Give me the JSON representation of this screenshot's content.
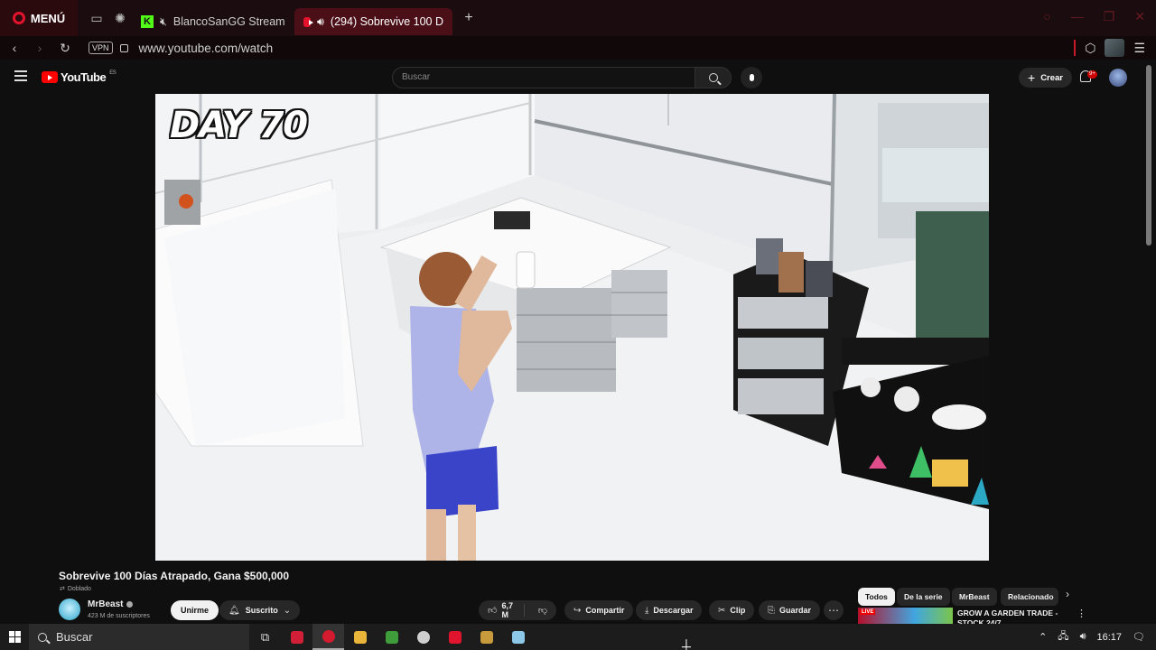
{
  "browser": {
    "menu_label": "MENÚ",
    "tabs": [
      {
        "label": "BlancoSanGG Stream",
        "icon": "kick-logo",
        "audio": "muted-speaker-icon"
      },
      {
        "label": "(294) Sobrevive 100 D",
        "icon": "youtube-icon",
        "audio": "speaker-icon",
        "active": true
      }
    ],
    "url": "www.youtube.com/watch",
    "vpn_label": "VPN",
    "accent_color": "#e3132b"
  },
  "youtube": {
    "logo_text": "YouTube",
    "region": "ES",
    "search_placeholder": "Buscar",
    "create_label": "Crear",
    "notification_count": "9+"
  },
  "video": {
    "overlay_text": "DAY 70",
    "title": "Sobrevive 100 Días Atrapado, Gana $500,000",
    "dubbed_label": "Doblado",
    "channel_name": "MrBeast",
    "subscribers": "423 M de suscriptores",
    "join_label": "Unirme",
    "subscribed_label": "Suscrito",
    "likes": "6,7 M",
    "share_label": "Compartir",
    "download_label": "Descargar",
    "clip_label": "Clip",
    "save_label": "Guardar"
  },
  "sidebar": {
    "chips": [
      "Todos",
      "De la serie",
      "MrBeast",
      "Relacionado"
    ],
    "rec_title": "GROW A GARDEN TRADE - STOCK 24/7",
    "rec_badge": "LIVE"
  },
  "taskbar": {
    "search_label": "Buscar",
    "time": "16:17"
  }
}
